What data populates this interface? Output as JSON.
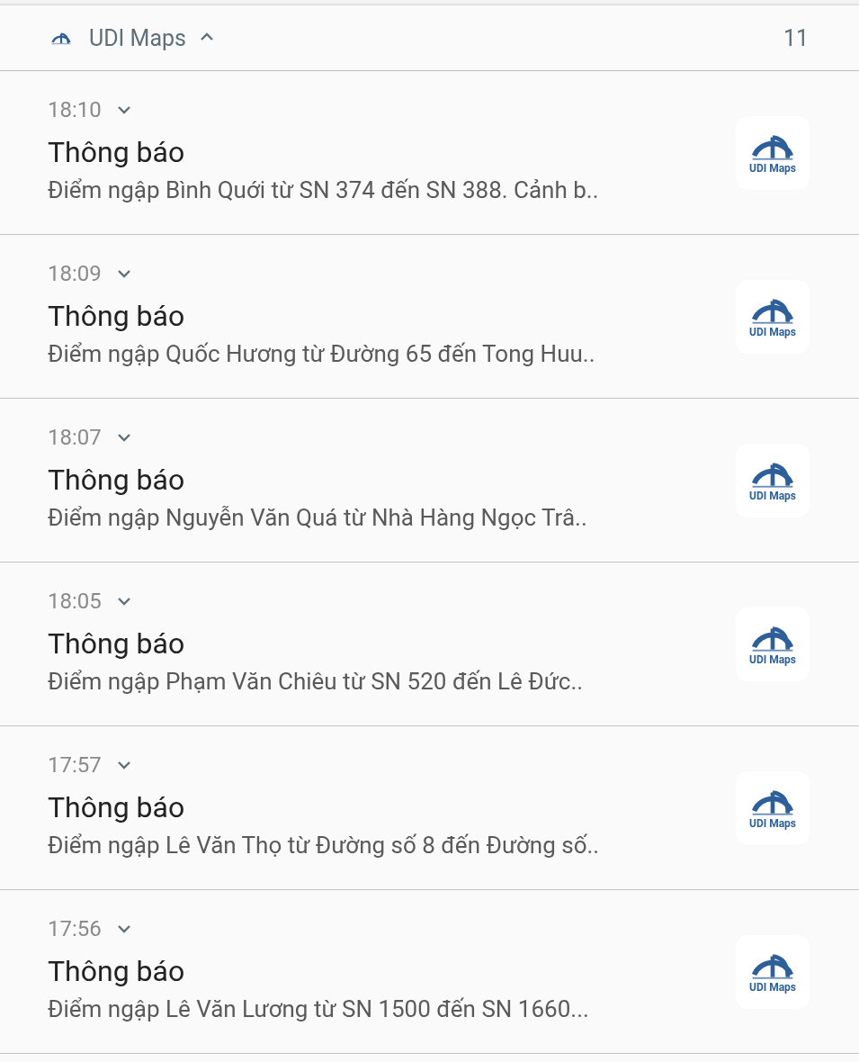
{
  "group": {
    "app_name": "UDI Maps",
    "expanded": true,
    "count": "11"
  },
  "notifications": [
    {
      "time": "18:10",
      "expanded": false,
      "title": "Thông báo",
      "body": "Điểm ngập Bình Quới từ SN 374 đến SN 388. Cảnh b..",
      "icon_label": "UDI Maps"
    },
    {
      "time": "18:09",
      "expanded": false,
      "title": "Thông báo",
      "body": "Điểm ngập Quốc Hương từ Đường 65 đến Tong Huu..",
      "icon_label": "UDI Maps"
    },
    {
      "time": "18:07",
      "expanded": false,
      "title": "Thông báo",
      "body": "Điểm ngập Nguyễn Văn Quá từ Nhà Hàng Ngọc Trâ..",
      "icon_label": "UDI Maps"
    },
    {
      "time": "18:05",
      "expanded": false,
      "title": "Thông báo",
      "body": "Điểm ngập Phạm Văn Chiêu từ SN 520 đến Lê Đức..",
      "icon_label": "UDI Maps"
    },
    {
      "time": "17:57",
      "expanded": false,
      "title": "Thông báo",
      "body": "Điểm ngập Lê Văn Thọ từ Đường số 8 đến Đường số..",
      "icon_label": "UDI Maps"
    },
    {
      "time": "17:56",
      "expanded": false,
      "title": "Thông báo",
      "body": "Điểm ngập Lê Văn Lương từ SN 1500 đến SN 1660...",
      "icon_label": "UDI Maps"
    }
  ]
}
